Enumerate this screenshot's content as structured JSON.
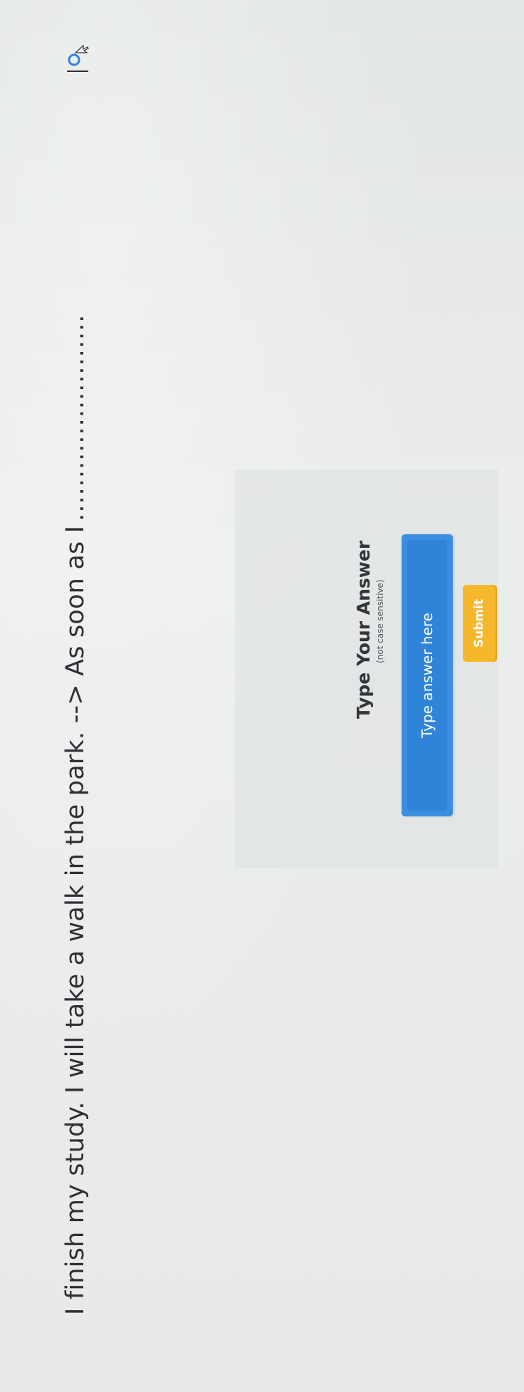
{
  "question": {
    "text": "I finish my study. I will take a walk in the park. --> As soon as I",
    "blank": "........................"
  },
  "answer_section": {
    "title": "Type Your Answer",
    "subtitle": "(not case sensitive)",
    "input_placeholder": "Type answer here",
    "input_value": "",
    "submit_label": "Submit"
  },
  "icons": {
    "cursor_tool": "pointer-cursor-icon"
  },
  "colors": {
    "background": "#e6e9e8",
    "text": "#2f2f36",
    "input_blue": "#2f84d9",
    "submit_yellow": "#f5b72c"
  }
}
